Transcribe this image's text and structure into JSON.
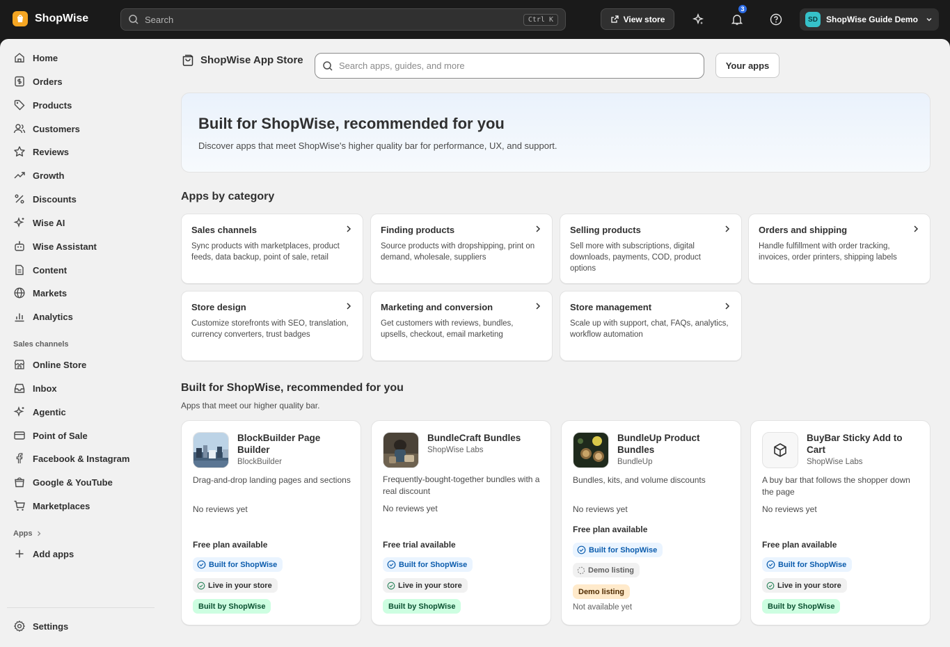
{
  "topbar": {
    "brand": "ShopWise",
    "search_placeholder": "Search",
    "shortcut": "Ctrl K",
    "view_store": "View store",
    "notification_count": "3",
    "store_initials": "SD",
    "store_name": "ShopWise Guide Demo"
  },
  "sidebar": {
    "items": [
      {
        "label": "Home",
        "icon": "home-icon"
      },
      {
        "label": "Orders",
        "icon": "orders-icon"
      },
      {
        "label": "Products",
        "icon": "tag-icon"
      },
      {
        "label": "Customers",
        "icon": "customers-icon"
      },
      {
        "label": "Reviews",
        "icon": "star-icon"
      },
      {
        "label": "Growth",
        "icon": "trend-icon"
      },
      {
        "label": "Discounts",
        "icon": "percent-icon"
      },
      {
        "label": "Wise AI",
        "icon": "sparkle-icon"
      },
      {
        "label": "Wise Assistant",
        "icon": "robot-icon"
      },
      {
        "label": "Content",
        "icon": "document-icon"
      },
      {
        "label": "Markets",
        "icon": "globe-icon"
      },
      {
        "label": "Analytics",
        "icon": "chart-icon"
      }
    ],
    "sales_channels_title": "Sales channels",
    "sales_channels": [
      {
        "label": "Online Store",
        "icon": "store-icon"
      },
      {
        "label": "Inbox",
        "icon": "inbox-icon"
      },
      {
        "label": "Agentic",
        "icon": "sparkle-icon"
      },
      {
        "label": "Point of Sale",
        "icon": "pos-icon"
      },
      {
        "label": "Facebook & Instagram",
        "icon": "facebook-icon"
      },
      {
        "label": "Google & YouTube",
        "icon": "bag-icon"
      },
      {
        "label": "Marketplaces",
        "icon": "cart-icon"
      }
    ],
    "apps_title": "Apps",
    "add_apps": "Add apps",
    "settings": "Settings"
  },
  "main": {
    "store_title": "ShopWise App Store",
    "search_placeholder": "Search apps, guides, and more",
    "your_apps": "Your apps",
    "hero": {
      "title": "Built for ShopWise, recommended for you",
      "subtitle": "Discover apps that meet ShopWise's higher quality bar for performance, UX, and support."
    },
    "categories_title": "Apps by category",
    "categories": [
      {
        "title": "Sales channels",
        "desc": "Sync products with marketplaces, product feeds, data backup, point of sale, retail"
      },
      {
        "title": "Finding products",
        "desc": "Source products with dropshipping, print on demand, wholesale, suppliers"
      },
      {
        "title": "Selling products",
        "desc": "Sell more with subscriptions, digital downloads, payments, COD, product options"
      },
      {
        "title": "Orders and shipping",
        "desc": "Handle fulfillment with order tracking, invoices, order printers, shipping labels"
      },
      {
        "title": "Store design",
        "desc": "Customize storefronts with SEO, translation, currency converters, trust badges"
      },
      {
        "title": "Marketing and conversion",
        "desc": "Get customers with reviews, bundles, upsells, checkout, email marketing"
      },
      {
        "title": "Store management",
        "desc": "Scale up with support, chat, FAQs, analytics, workflow automation"
      }
    ],
    "recommended_title": "Built for ShopWise, recommended for you",
    "recommended_sub": "Apps that meet our higher quality bar.",
    "apps": [
      {
        "name": "BlockBuilder Page Builder",
        "developer": "BlockBuilder",
        "desc": "Drag-and-drop landing pages and sections",
        "reviews": "No reviews yet",
        "pricing": "Free plan available",
        "badge_built_for": "Built for ShopWise",
        "badge_live": "Live in your store",
        "badge_built_by": "Built by ShopWise"
      },
      {
        "name": "BundleCraft Bundles",
        "developer": "ShopWise Labs",
        "desc": "Frequently-bought-together bundles with a real discount",
        "reviews": "No reviews yet",
        "pricing": "Free trial available",
        "badge_built_for": "Built for ShopWise",
        "badge_live": "Live in your store",
        "badge_built_by": "Built by ShopWise"
      },
      {
        "name": "BundleUp Product Bundles",
        "developer": "BundleUp",
        "desc": "Bundles, kits, and volume discounts",
        "reviews": "No reviews yet",
        "pricing": "Free plan available",
        "badge_built_for": "Built for ShopWise",
        "badge_demo": "Demo listing",
        "badge_demo2": "Demo listing",
        "note": "Not available yet"
      },
      {
        "name": "BuyBar Sticky Add to Cart",
        "developer": "ShopWise Labs",
        "desc": "A buy bar that follows the shopper down the page",
        "reviews": "No reviews yet",
        "pricing": "Free plan available",
        "badge_built_for": "Built for ShopWise",
        "badge_live": "Live in your store",
        "badge_built_by": "Built by ShopWise"
      }
    ]
  },
  "colors": {
    "topbar": "#1a1a1a",
    "background": "#f1f1f1",
    "brand_logo": "#f5a623",
    "badge_blue": "#0b5cad",
    "badge_green_bg": "#cdfee1",
    "notification": "#2b6ae3"
  }
}
